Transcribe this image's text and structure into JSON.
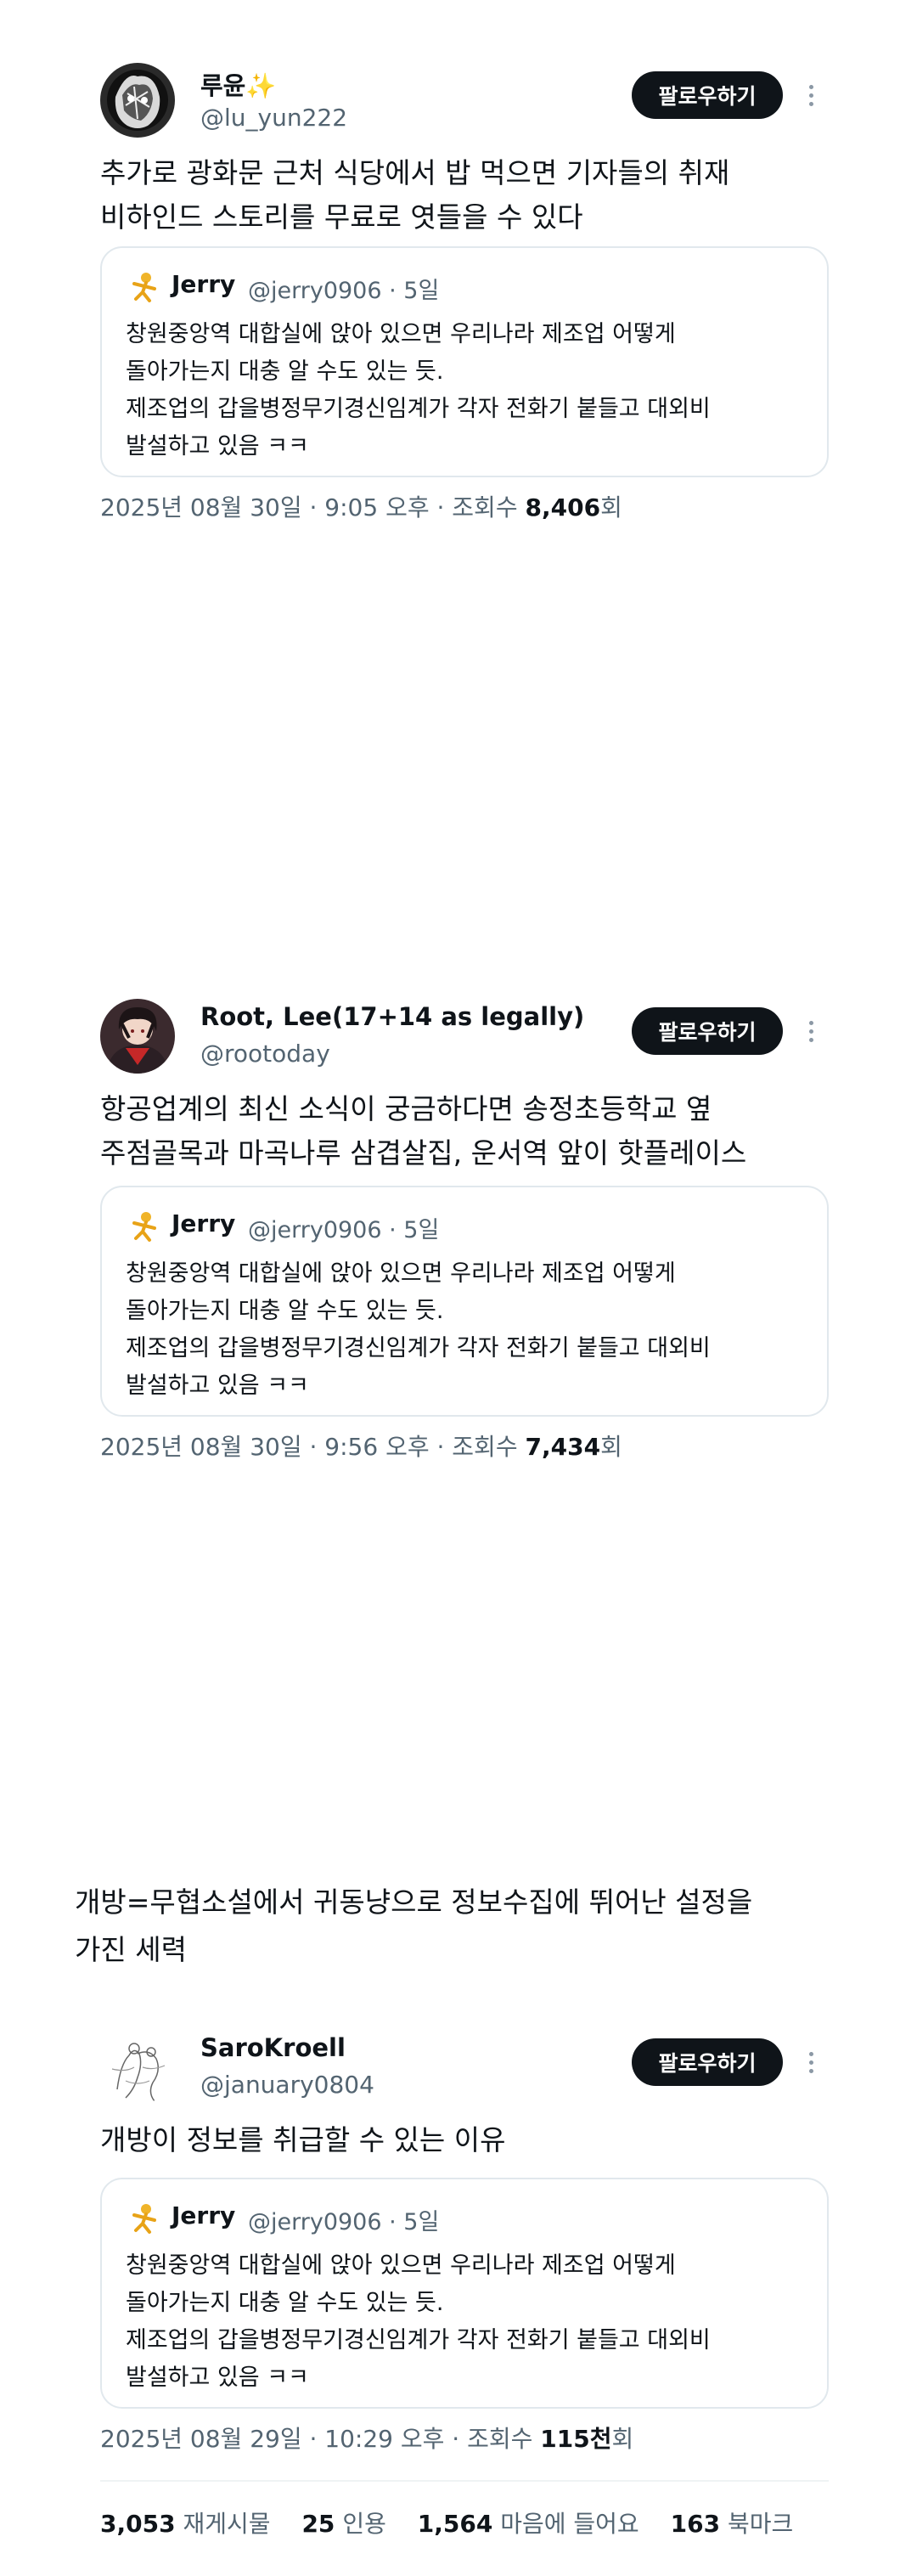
{
  "posts": [
    {
      "name": "루윤✨",
      "handle": "@lu_yun222",
      "follow_label": "팔로우하기",
      "text": "추가로 광화문 근처 식당에서 밥 먹으면 기자들의 취재\n비하인드 스토리를 무료로 엿들을 수 있다",
      "quote": {
        "name": "Jerry",
        "meta": "@jerry0906 · 5일",
        "text": "창원중앙역 대합실에 앉아 있으면 우리나라 제조업 어떻게\n돌아가는지 대충 알 수도 있는 듯.\n제조업의 갑을병정무기경신임계가 각자 전화기 붙들고 대외비\n발설하고 있음 ㅋㅋ"
      },
      "timestamp": "2025년 08월 30일 · 9:05 오후 · 조회수 ",
      "views": "8,406",
      "views_suffix": "회"
    },
    {
      "name": "Root, Lee(17+14 as legally)",
      "handle": "@rootoday",
      "follow_label": "팔로우하기",
      "text": "항공업계의 최신 소식이 궁금하다면 송정초등학교 옆\n주점골목과 마곡나루 삼겹살집, 운서역 앞이 핫플레이스",
      "quote": {
        "name": "Jerry",
        "meta": "@jerry0906 · 5일",
        "text": "창원중앙역 대합실에 앉아 있으면 우리나라 제조업 어떻게\n돌아가는지 대충 알 수도 있는 듯.\n제조업의 갑을병정무기경신임계가 각자 전화기 붙들고 대외비\n발설하고 있음 ㅋㅋ"
      },
      "timestamp": "2025년 08월 30일 · 9:56 오후 · 조회수 ",
      "views": "7,434",
      "views_suffix": "회"
    },
    {
      "name": "SaroKroell",
      "handle": "@january0804",
      "follow_label": "팔로우하기",
      "text": "개방이 정보를 취급할 수 있는 이유",
      "quote": {
        "name": "Jerry",
        "meta": "@jerry0906 · 5일",
        "text": "창원중앙역 대합실에 앉아 있으면 우리나라 제조업 어떻게\n돌아가는지 대충 알 수도 있는 듯.\n제조업의 갑을병정무기경신임계가 각자 전화기 붙들고 대외비\n발설하고 있음 ㅋㅋ"
      },
      "timestamp": "2025년 08월 29일 · 10:29 오후 · 조회수 ",
      "views": "115천",
      "views_suffix": "회"
    }
  ],
  "caption": "개방=무협소설에서 귀동냥으로 정보수집에 뛰어난 설정을\n가진 세력",
  "stats": {
    "reposts_count": "3,053",
    "reposts_label": "재게시물",
    "quotes_count": "25",
    "quotes_label": "인용",
    "likes_count": "1,564",
    "likes_label": "마음에 들어요",
    "bookmarks_count": "163",
    "bookmarks_label": "북마크"
  },
  "icons": {
    "quote_avatar": "dancing-figure-icon",
    "more": "more-vertical-icon"
  },
  "colors": {
    "text": "#0f1419",
    "muted": "#536471",
    "button": "#0f1419",
    "border": "#e1e8ed"
  }
}
